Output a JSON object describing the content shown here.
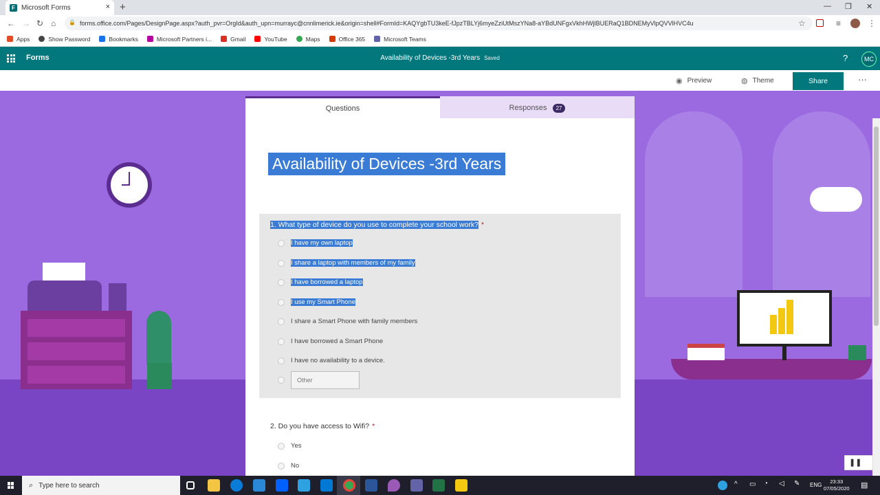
{
  "browser": {
    "tab_title": "Microsoft Forms",
    "tab_close": "×",
    "new_tab": "+",
    "window_controls": [
      "—",
      "❐",
      "✕"
    ],
    "url": "forms.office.com/Pages/DesignPage.aspx?auth_pvr=OrgId&auth_upn=murrayc@cnnlimerick.ie&origin=shell#FormId=KAQYgbTU3keE-fJpzTBLYj6myeZziUtMszYNa8-aYBdUNFgxVkhHWjlBUERaQ1BDNEMyVlpQVVlHVC4u",
    "bookmarks": [
      {
        "label": "Apps",
        "color": "#e34c26"
      },
      {
        "label": "Show Password",
        "color": "#444444"
      },
      {
        "label": "Bookmarks",
        "color": "#1a73e8"
      },
      {
        "label": "Microsoft Partners i...",
        "color": "#b4009e"
      },
      {
        "label": "Gmail",
        "color": "#d93025"
      },
      {
        "label": "YouTube",
        "color": "#ff0000"
      },
      {
        "label": "Maps",
        "color": "#34a853"
      },
      {
        "label": "Office 365",
        "color": "#d83b01"
      },
      {
        "label": "Microsoft Teams",
        "color": "#6264a7"
      }
    ]
  },
  "forms_header": {
    "app_name": "Forms",
    "form_title": "Availability of Devices -3rd Years",
    "status": "Saved",
    "help": "?",
    "avatar": "MC"
  },
  "commands": {
    "preview": "Preview",
    "theme": "Theme",
    "share": "Share",
    "more": "···"
  },
  "tabs": {
    "questions": "Questions",
    "responses": "Responses",
    "responses_count": "27"
  },
  "form": {
    "title": "Availability of Devices -3rd Years",
    "q1": {
      "text": "1. What type of device do you use to complete your school work?",
      "required": "*",
      "options": [
        {
          "label": "I have my own laptop",
          "selected_text": true
        },
        {
          "label": "I share a laptop with members of my family",
          "selected_text": true
        },
        {
          "label": "I have borrowed a laptop",
          "selected_text": true
        },
        {
          "label": "I use my Smart Phone",
          "selected_text": true
        },
        {
          "label": "I share a Smart Phone with family members",
          "selected_text": false
        },
        {
          "label": "I have borrowed a Smart Phone",
          "selected_text": false
        },
        {
          "label": "I have no availability to a device.",
          "selected_text": false
        }
      ],
      "other_placeholder": "Other"
    },
    "q2": {
      "text": "2. Do you have access to Wifi?",
      "required": "*",
      "options": [
        "Yes",
        "No"
      ]
    }
  },
  "taskbar": {
    "search_placeholder": "Type here to search",
    "language": "ENG",
    "time": "23:33",
    "date": "07/05/2020",
    "apps": [
      {
        "name": "task-view",
        "color": "#ffffff"
      },
      {
        "name": "file-explorer",
        "color": "#f4c542"
      },
      {
        "name": "edge",
        "color": "#0a7bd6"
      },
      {
        "name": "store",
        "color": "#2b88d8"
      },
      {
        "name": "dropbox",
        "color": "#0061fe"
      },
      {
        "name": "app-blue",
        "color": "#2ea1e0"
      },
      {
        "name": "mail",
        "color": "#0078d4"
      },
      {
        "name": "chrome",
        "color": "#34a853"
      },
      {
        "name": "word",
        "color": "#2b579a"
      },
      {
        "name": "app-purple",
        "color": "#9b59b6"
      },
      {
        "name": "teams",
        "color": "#6264a7"
      },
      {
        "name": "excel",
        "color": "#217346"
      },
      {
        "name": "app-yellow",
        "color": "#f2c811"
      }
    ]
  },
  "recording_widget": {
    "pause": "❚❚"
  }
}
